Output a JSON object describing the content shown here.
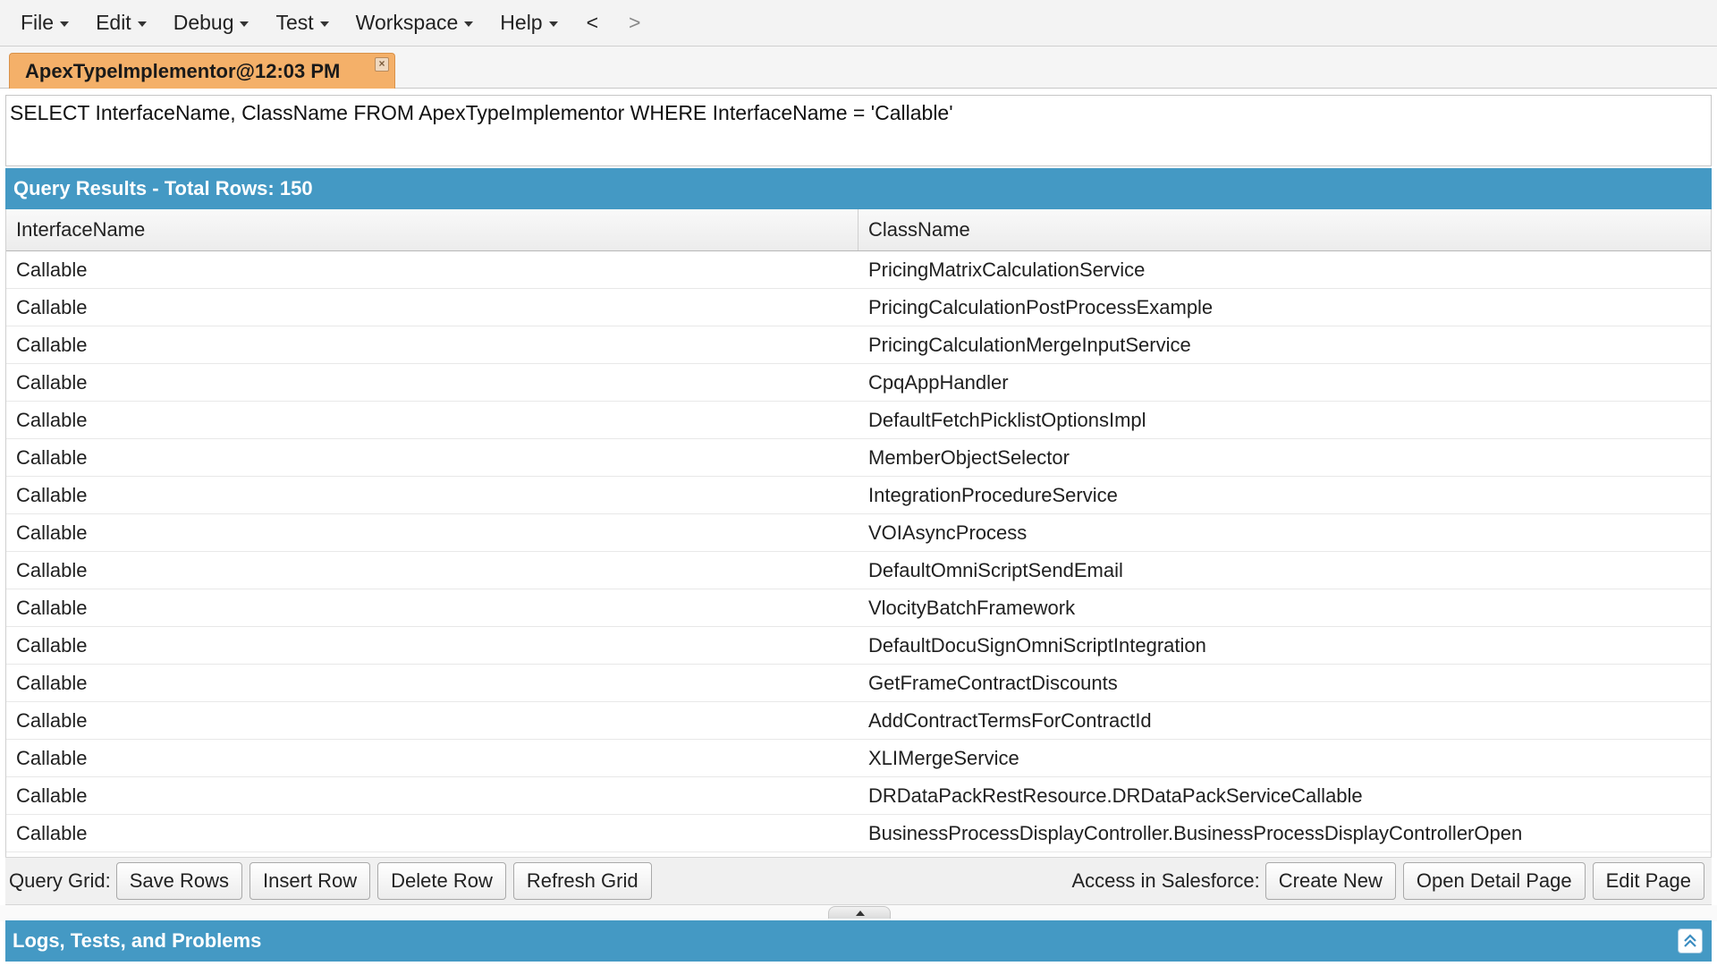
{
  "menu": {
    "items": [
      {
        "label": "File"
      },
      {
        "label": "Edit"
      },
      {
        "label": "Debug"
      },
      {
        "label": "Test"
      },
      {
        "label": "Workspace"
      },
      {
        "label": "Help"
      }
    ],
    "back_label": "<",
    "forward_label": ">"
  },
  "tab": {
    "label": "ApexTypeImplementor@12:03 PM",
    "close_glyph": "×"
  },
  "editor": {
    "query": "SELECT InterfaceName, ClassName FROM ApexTypeImplementor WHERE InterfaceName = 'Callable'"
  },
  "results": {
    "title": "Query Results - Total Rows: 150",
    "columns": [
      "InterfaceName",
      "ClassName"
    ],
    "rows": [
      [
        "Callable",
        "PricingMatrixCalculationService"
      ],
      [
        "Callable",
        "PricingCalculationPostProcessExample"
      ],
      [
        "Callable",
        "PricingCalculationMergeInputService"
      ],
      [
        "Callable",
        "CpqAppHandler"
      ],
      [
        "Callable",
        "DefaultFetchPicklistOptionsImpl"
      ],
      [
        "Callable",
        "MemberObjectSelector"
      ],
      [
        "Callable",
        "IntegrationProcedureService"
      ],
      [
        "Callable",
        "VOIAsyncProcess"
      ],
      [
        "Callable",
        "DefaultOmniScriptSendEmail"
      ],
      [
        "Callable",
        "VlocityBatchFramework"
      ],
      [
        "Callable",
        "DefaultDocuSignOmniScriptIntegration"
      ],
      [
        "Callable",
        "GetFrameContractDiscounts"
      ],
      [
        "Callable",
        "AddContractTermsForContractId"
      ],
      [
        "Callable",
        "XLIMergeService"
      ],
      [
        "Callable",
        "DRDataPackRestResource.DRDataPackServiceCallable"
      ],
      [
        "Callable",
        "BusinessProcessDisplayController.BusinessProcessDisplayControllerOpen"
      ]
    ]
  },
  "toolbar": {
    "query_grid_label": "Query Grid:",
    "save_rows": "Save Rows",
    "insert_row": "Insert Row",
    "delete_row": "Delete Row",
    "refresh_grid": "Refresh Grid",
    "access_label": "Access in Salesforce:",
    "create_new": "Create New",
    "open_detail_page": "Open Detail Page",
    "edit_page": "Edit Page"
  },
  "logs": {
    "title": "Logs, Tests, and Problems"
  },
  "colors": {
    "panel_header": "#4499c4",
    "tab_active": "#f4b069"
  }
}
